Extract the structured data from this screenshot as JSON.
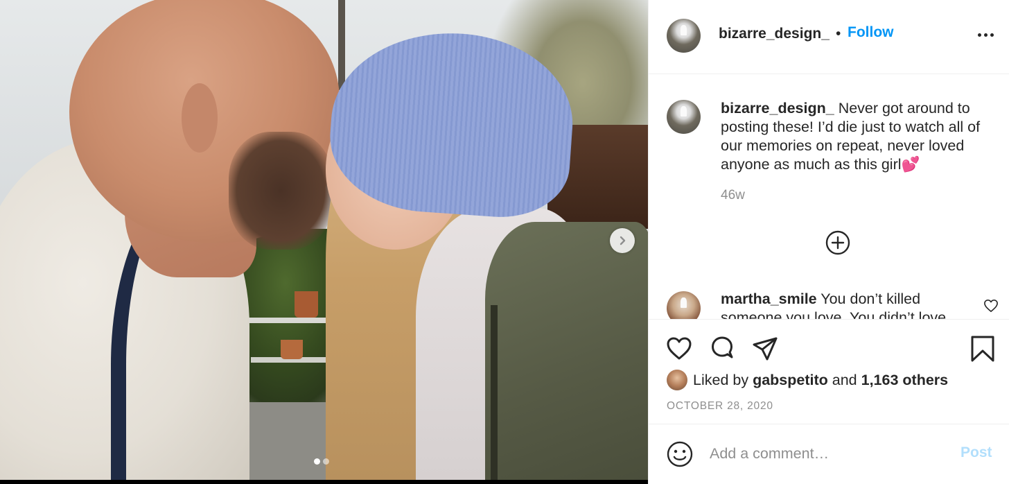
{
  "post": {
    "username": "bizarre_design_",
    "follow_label": "Follow",
    "separator": "•"
  },
  "caption": {
    "username": "bizarre_design_",
    "text": "Never got around to posting these! I’d die just to watch all of our memories on repeat, never loved anyone as much as this girl",
    "emoji": "💕",
    "time": "46w"
  },
  "comments": [
    {
      "username": "martha_smile",
      "text": "You don’t killed someone you love. You didn’t love"
    }
  ],
  "likes": {
    "prefix": "Liked by",
    "user": "gabspetito",
    "middle": "and",
    "count": "1,163 others"
  },
  "date": "OCTOBER 28, 2020",
  "comment_box": {
    "placeholder": "Add a comment…",
    "post_label": "Post"
  },
  "carousel": {
    "current": 1,
    "total": 2
  },
  "colors": {
    "follow": "#0095f6",
    "post_disabled": "#b2dffc",
    "muted": "#8e8e8e",
    "text": "#262626"
  },
  "icons": [
    "more-options-icon",
    "add-circle-icon",
    "like-heart-icon",
    "comment-icon",
    "share-icon",
    "save-bookmark-icon",
    "emoji-icon",
    "chevron-right-icon"
  ]
}
